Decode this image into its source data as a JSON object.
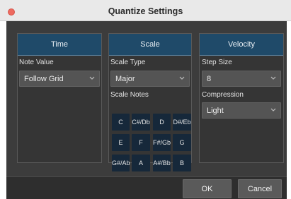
{
  "window": {
    "title": "Quantize Settings"
  },
  "time": {
    "header": "Time",
    "note_value_label": "Note Value",
    "note_value": "Follow Grid"
  },
  "scale": {
    "header": "Scale",
    "scale_type_label": "Scale Type",
    "scale_type": "Major",
    "scale_notes_label": "Scale Notes",
    "notes": [
      "C",
      "C#/Db",
      "D",
      "D#/Eb",
      "E",
      "F",
      "F#/Gb",
      "G",
      "G#/Ab",
      "A",
      "A#/Bb",
      "B"
    ]
  },
  "velocity": {
    "header": "Velocity",
    "step_size_label": "Step Size",
    "step_size": "8",
    "compression_label": "Compression",
    "compression": "Light"
  },
  "buttons": {
    "ok": "OK",
    "cancel": "Cancel"
  },
  "colors": {
    "panel_header": "#1f4a69",
    "note_button": "#16283a",
    "close_button": "#ee6a5f",
    "dialog_background": "#3c3c3c"
  },
  "icons": {
    "dropdown": "chevron-down-icon",
    "close": "close-icon"
  }
}
